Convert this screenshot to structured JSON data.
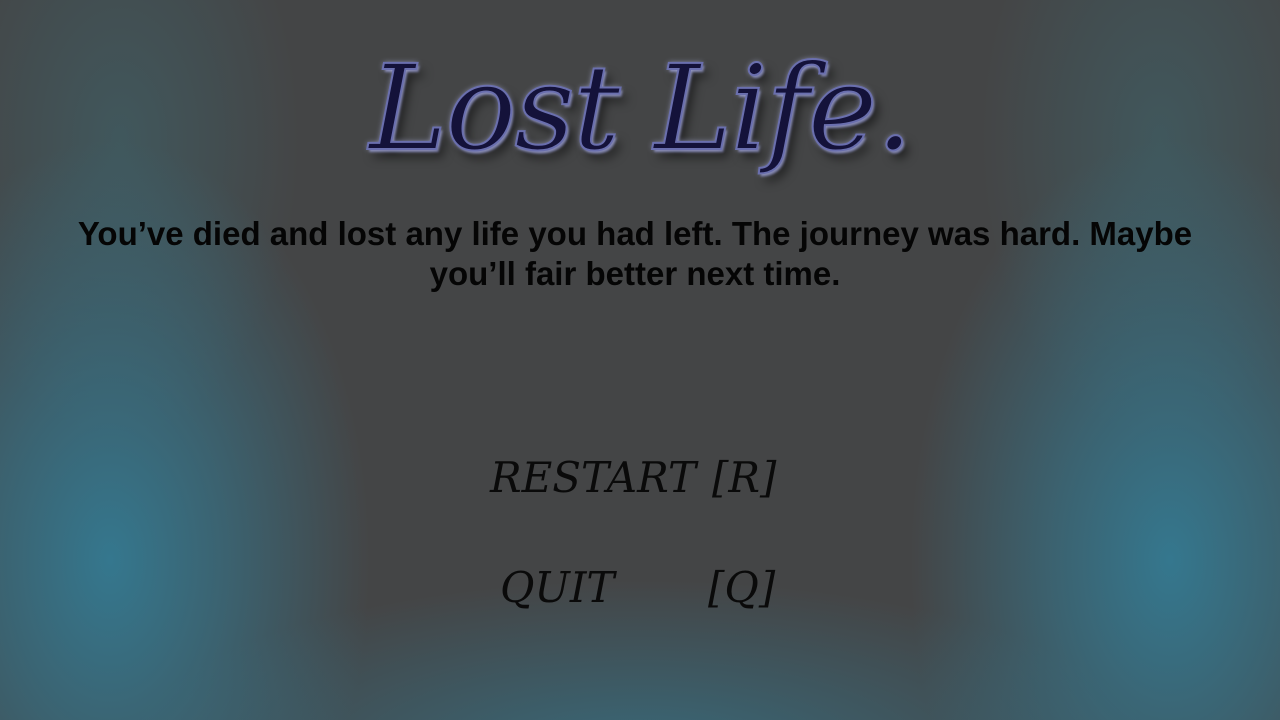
{
  "screen": {
    "title": "Lost Life.",
    "message": "You’ve died and lost any life you had left.  The journey was hard.  Maybe you’ll fair better next time."
  },
  "menu": {
    "restart_label": "RESTART",
    "restart_key": "[R]",
    "quit_label": "QUIT",
    "quit_key": "[Q]"
  },
  "colors": {
    "background": "#444546",
    "glow": "#347a92",
    "title_fill": "#14123a",
    "text": "#050505"
  }
}
